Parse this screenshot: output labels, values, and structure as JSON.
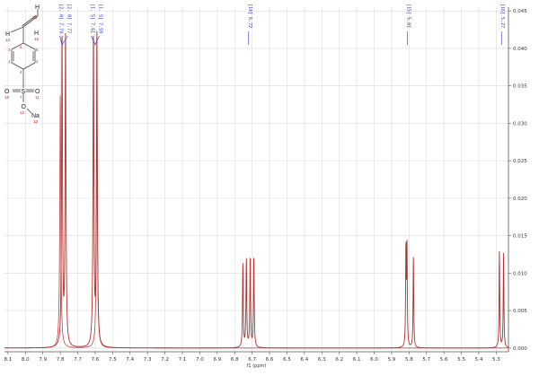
{
  "chart_data": {
    "type": "line",
    "title": "",
    "xlabel": "f1 (ppm)",
    "ylabel": "",
    "xlim": [
      8.12,
      5.23
    ],
    "ylim": [
      -0.0005,
      0.0455
    ],
    "x_ticks": [
      "8.1",
      "8.0",
      "7.9",
      "7.8",
      "7.7",
      "7.6",
      "7.5",
      "7.4",
      "7.3",
      "7.2",
      "7.1",
      "7.0",
      "6.9",
      "6.8",
      "6.7",
      "6.6",
      "6.5",
      "6.4",
      "6.3",
      "6.2",
      "6.1",
      "6.0",
      "5.9",
      "5.8",
      "5.7",
      "5.6",
      "5.5",
      "5.4",
      "5.3"
    ],
    "y_ticks": [
      "0.000",
      "0.005",
      "0.010",
      "0.015",
      "0.020",
      "0.025",
      "0.030",
      "0.035",
      "0.040",
      "0.045"
    ],
    "grid": true,
    "line_color": "#b03030",
    "integral_color": "#d04040",
    "peaks": [
      {
        "x": 7.79,
        "y": 0.0415,
        "width": 0.003
      },
      {
        "x": 7.77,
        "y": 0.0415,
        "width": 0.003
      },
      {
        "x": 7.61,
        "y": 0.0415,
        "width": 0.003
      },
      {
        "x": 7.59,
        "y": 0.0415,
        "width": 0.003
      },
      {
        "x": 6.753,
        "y": 0.0111,
        "width": 0.0025
      },
      {
        "x": 6.733,
        "y": 0.0117,
        "width": 0.0025
      },
      {
        "x": 6.711,
        "y": 0.0119,
        "width": 0.0025
      },
      {
        "x": 6.69,
        "y": 0.0121,
        "width": 0.0025
      },
      {
        "x": 5.818,
        "y": 0.0128,
        "width": 0.0022
      },
      {
        "x": 5.812,
        "y": 0.013,
        "width": 0.0022
      },
      {
        "x": 5.775,
        "y": 0.0122,
        "width": 0.0022
      },
      {
        "x": 5.282,
        "y": 0.0128,
        "width": 0.0022
      },
      {
        "x": 5.258,
        "y": 0.0126,
        "width": 0.0022
      }
    ],
    "integral_peaks": [
      {
        "x": 7.8,
        "y": 0.0338
      },
      {
        "x": 7.59,
        "y": 0.0338
      }
    ],
    "peak_labels": [
      {
        "ppm": 7.79,
        "text": "[2. 0] 7.79"
      },
      {
        "ppm": 7.77,
        "text": "[2. 0] 7.77"
      },
      {
        "ppm": 7.61,
        "text": "[1. 5] 7.61"
      },
      {
        "ppm": 7.59,
        "text": "[1. 5] 7.59"
      },
      {
        "ppm": 6.72,
        "text": "[14] 6.72"
      },
      {
        "ppm": 5.81,
        "text": "[15] 5.81"
      },
      {
        "ppm": 5.27,
        "text": "[16] 5.27"
      }
    ]
  },
  "structure": {
    "atoms": [
      "H",
      "H",
      "H",
      "S",
      "O",
      "O",
      "O",
      "Na"
    ],
    "atom_numbers": [
      "16",
      "14",
      "15",
      "5",
      "3",
      "6",
      "1",
      "2",
      "4",
      "7",
      "10",
      "11",
      "12",
      "13"
    ]
  }
}
